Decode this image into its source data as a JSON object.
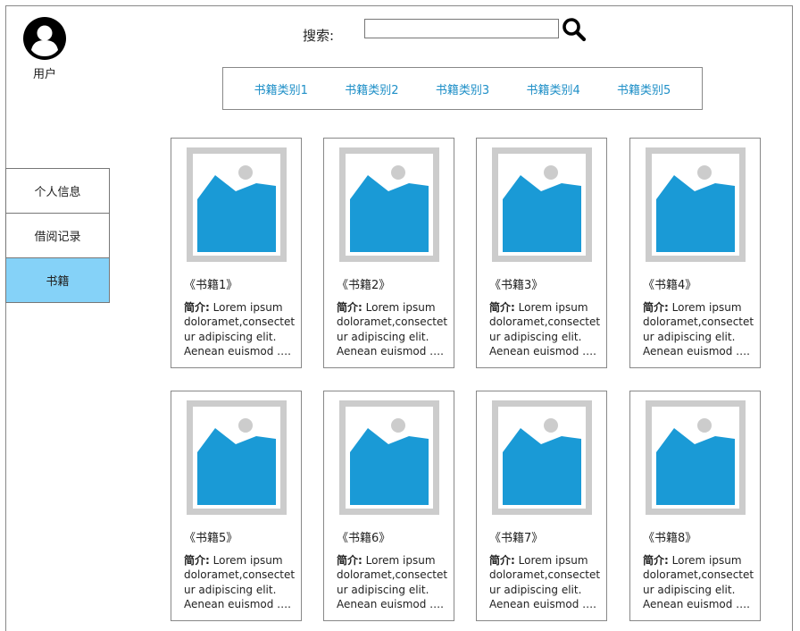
{
  "user": {
    "label": "用户",
    "icon": "user-avatar-icon"
  },
  "search": {
    "label": "搜索:",
    "value": "",
    "placeholder": "",
    "icon": "search-icon"
  },
  "categories": [
    "书籍类别1",
    "书籍类别2",
    "书籍类别3",
    "书籍类别4",
    "书籍类别5"
  ],
  "sidebar": {
    "items": [
      {
        "label": "个人信息",
        "active": false
      },
      {
        "label": "借阅记录",
        "active": false
      },
      {
        "label": "书籍",
        "active": true
      }
    ]
  },
  "books": [
    {
      "title": "《书籍1》",
      "desc_label": "简介:",
      "desc_lines": [
        "Lorem ipsum",
        "doloramet,consectet",
        "ur adipiscing elit.",
        "Aenean euismod …."
      ]
    },
    {
      "title": "《书籍2》",
      "desc_label": "简介:",
      "desc_lines": [
        "Lorem ipsum",
        "doloramet,consectet",
        "ur adipiscing elit.",
        "Aenean euismod …."
      ]
    },
    {
      "title": "《书籍3》",
      "desc_label": "简介:",
      "desc_lines": [
        "Lorem ipsum",
        "doloramet,consectet",
        "ur adipiscing elit.",
        "Aenean euismod …."
      ]
    },
    {
      "title": "《书籍4》",
      "desc_label": "简介:",
      "desc_lines": [
        "Lorem ipsum",
        "doloramet,consectet",
        "ur adipiscing elit.",
        "Aenean euismod …."
      ]
    },
    {
      "title": "《书籍5》",
      "desc_label": "简介:",
      "desc_lines": [
        "Lorem ipsum",
        "doloramet,consectet",
        "ur adipiscing elit.",
        "Aenean euismod …."
      ]
    },
    {
      "title": "《书籍6》",
      "desc_label": "简介:",
      "desc_lines": [
        "Lorem ipsum",
        "doloramet,consectet",
        "ur adipiscing elit.",
        "Aenean euismod …."
      ]
    },
    {
      "title": "《书籍7》",
      "desc_label": "简介:",
      "desc_lines": [
        "Lorem ipsum",
        "doloramet,consectet",
        "ur adipiscing elit.",
        "Aenean euismod …."
      ]
    },
    {
      "title": "《书籍8》",
      "desc_label": "简介:",
      "desc_lines": [
        "Lorem ipsum",
        "doloramet,consectet",
        "ur adipiscing elit.",
        "Aenean euismod …."
      ]
    }
  ],
  "colors": {
    "accent": "#1e8fc7",
    "active_bg": "#85d2f8",
    "image_blue": "#1a9ad6",
    "image_frame": "#cccccc"
  },
  "image_icon": "image-placeholder-icon"
}
